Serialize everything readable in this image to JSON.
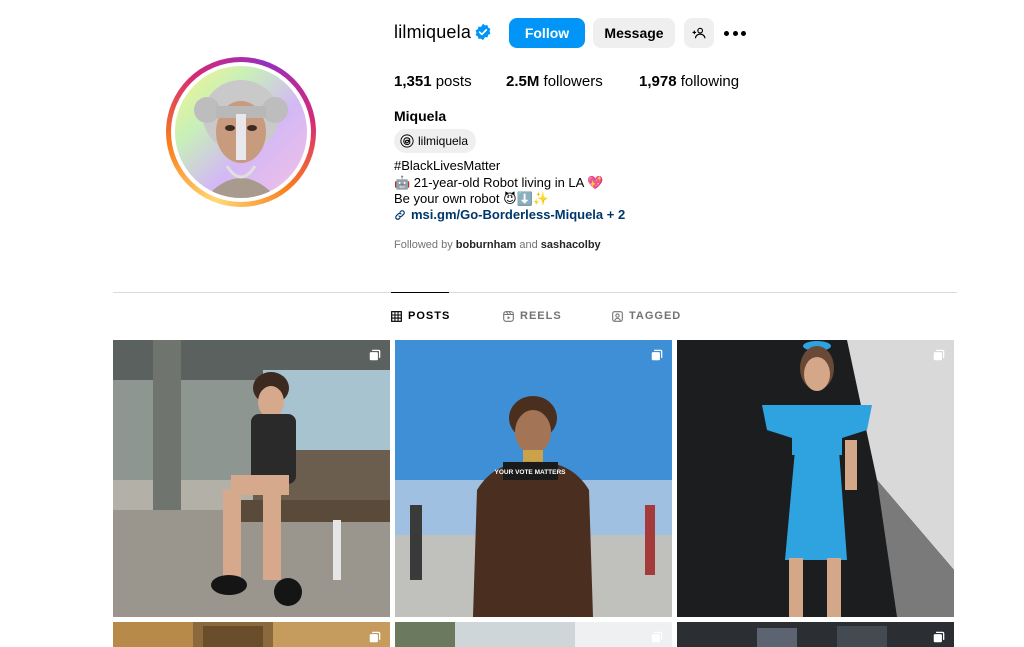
{
  "profile": {
    "username": "lilmiquela",
    "verified": true,
    "follow_label": "Follow",
    "message_label": "Message",
    "posts_count": "1,351",
    "posts_label": "posts",
    "followers_count": "2.5M",
    "followers_label": "followers",
    "following_count": "1,978",
    "following_label": "following",
    "full_name": "Miquela",
    "threads_handle": "lilmiquela",
    "bio_line1": "#BlackLivesMatter",
    "bio_line2": "🤖 21-year-old Robot living in LA 💖",
    "bio_line3": "Be your own robot 😈⬇️✨",
    "bio_link": "msi.gm/Go-Borderless-Miquela + 2",
    "followed_by_prefix": "Followed by",
    "followed_by_user1": "boburnham",
    "followed_by_and": "and",
    "followed_by_user2": "sashacolby"
  },
  "tabs": {
    "posts": "POSTS",
    "reels": "REELS",
    "tagged": "TAGGED",
    "active": "posts"
  },
  "grid": {
    "post1_sign": "YOUR VOTE MATTERS"
  },
  "icons": {
    "verified": "verified-badge-icon",
    "add_user": "add-user-icon",
    "more": "more-options-icon",
    "threads": "threads-icon",
    "link": "link-icon",
    "posts_tab": "grid-icon",
    "reels_tab": "reels-icon",
    "tagged_tab": "tagged-icon",
    "carousel": "multiple-posts-icon"
  },
  "colors": {
    "accent": "#0095f6",
    "link": "#00376b",
    "muted": "#737373"
  }
}
